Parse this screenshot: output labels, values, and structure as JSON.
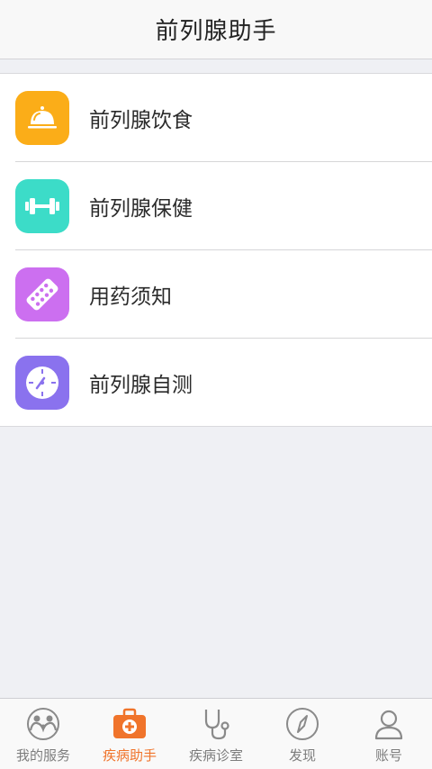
{
  "header": {
    "title": "前列腺助手"
  },
  "menu": {
    "items": [
      {
        "label": "前列腺饮食",
        "icon": "service-bell-icon",
        "color": "#fbad18"
      },
      {
        "label": "前列腺保健",
        "icon": "dumbbell-icon",
        "color": "#3cdcc8"
      },
      {
        "label": "用药须知",
        "icon": "pill-strip-icon",
        "color": "#cc6ff0"
      },
      {
        "label": "前列腺自测",
        "icon": "gauge-icon",
        "color": "#8a72ee"
      }
    ]
  },
  "tabbar": {
    "active_color": "#f0742b",
    "tabs": [
      {
        "label": "我的服务",
        "icon": "family-icon",
        "active": false
      },
      {
        "label": "疾病助手",
        "icon": "medical-kit-icon",
        "active": true
      },
      {
        "label": "疾病诊室",
        "icon": "stethoscope-icon",
        "active": false
      },
      {
        "label": "发现",
        "icon": "compass-icon",
        "active": false
      },
      {
        "label": "账号",
        "icon": "user-icon",
        "active": false
      }
    ]
  }
}
